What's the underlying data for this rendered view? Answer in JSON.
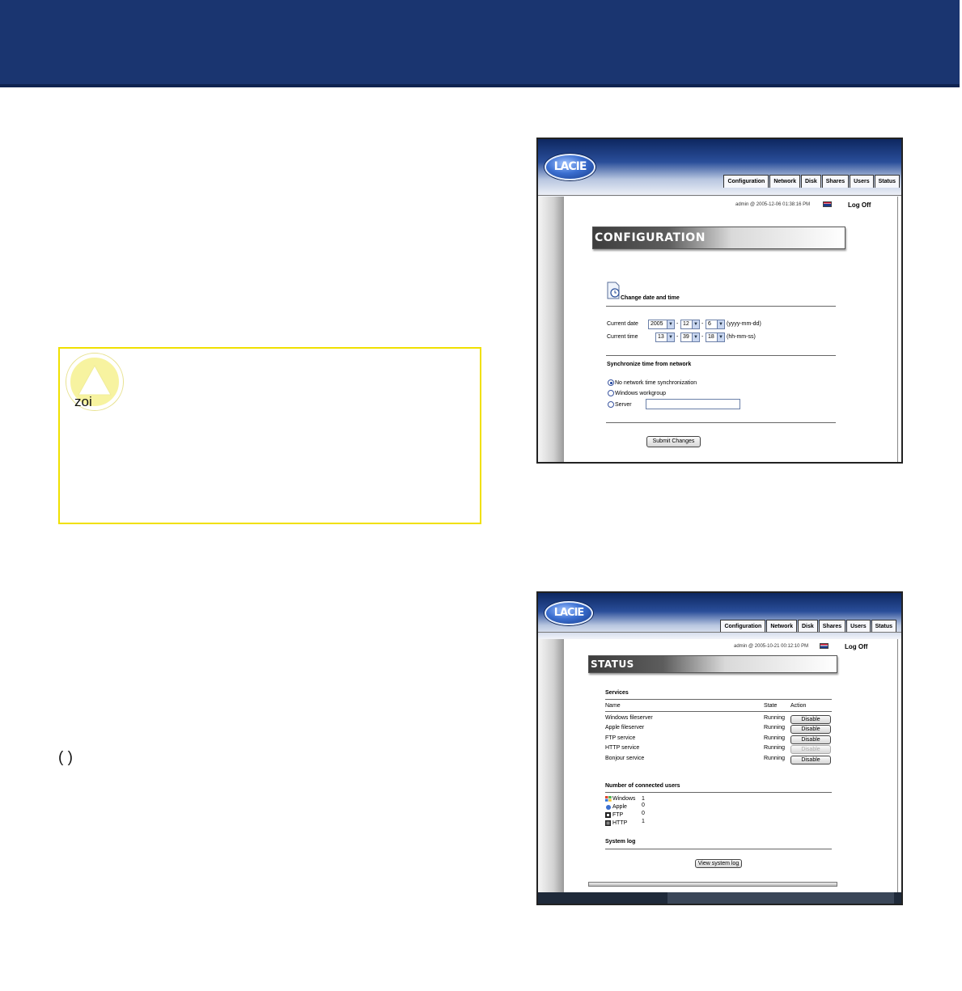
{
  "colors": {
    "banner": "#1a3570",
    "caution_border": "#f0e000",
    "caution_icon": "#f7f3a0"
  },
  "caution": {
    "icon": "warning-triangle-icon",
    "text_fragment": "zoi"
  },
  "paren_fragment": "(        )",
  "config_screen": {
    "logo": "LACIE",
    "tabs": [
      "Configuration",
      "Network",
      "Disk",
      "Shares",
      "Users",
      "Status"
    ],
    "user_info": "admin  @  2005-12-06 01:38:16 PM",
    "log_off": "Log Off",
    "page_title": "CONFIGURATION",
    "section_title": "Change date and time",
    "current_date_label": "Current date",
    "date": {
      "year": "2005",
      "month": "12",
      "day": "6",
      "format": "(yyyy-mm-dd)"
    },
    "current_time_label": "Current time",
    "time": {
      "hour": "13",
      "minute": "39",
      "second": "18",
      "format": "(hh-mm-ss)"
    },
    "sync_title": "Synchronize time from network",
    "sync_options": [
      "No network time synchronization",
      "Windows workgroup",
      "Server"
    ],
    "sync_selected": 0,
    "server_value": "",
    "submit_label": "Submit Changes"
  },
  "status_screen": {
    "logo": "LACIE",
    "tabs": [
      "Configuration",
      "Network",
      "Disk",
      "Shares",
      "Users",
      "Status"
    ],
    "user_info": "admin  @  2005-10-21 00:12:10 PM",
    "log_off": "Log Off",
    "page_title": "STATUS",
    "services_title": "Services",
    "columns": {
      "name": "Name",
      "state": "State",
      "action": "Action"
    },
    "services": [
      {
        "name": "Windows fileserver",
        "state": "Running",
        "action": "Disable",
        "enabled": true
      },
      {
        "name": "Apple fileserver",
        "state": "Running",
        "action": "Disable",
        "enabled": true
      },
      {
        "name": "FTP service",
        "state": "Running",
        "action": "Disable",
        "enabled": true
      },
      {
        "name": "HTTP service",
        "state": "Running",
        "action": "Disable",
        "enabled": false
      },
      {
        "name": "Bonjour service",
        "state": "Running",
        "action": "Disable",
        "enabled": true
      }
    ],
    "users_title": "Number of connected users",
    "connected": [
      {
        "name": "Windows",
        "count": "1",
        "icon": "windows-icon"
      },
      {
        "name": "Apple",
        "count": "0",
        "icon": "apple-icon"
      },
      {
        "name": "FTP",
        "count": "0",
        "icon": "ftp-icon"
      },
      {
        "name": "HTTP",
        "count": "1",
        "icon": "http-icon"
      }
    ],
    "syslog_title": "System log",
    "syslog_button": "View system log"
  }
}
